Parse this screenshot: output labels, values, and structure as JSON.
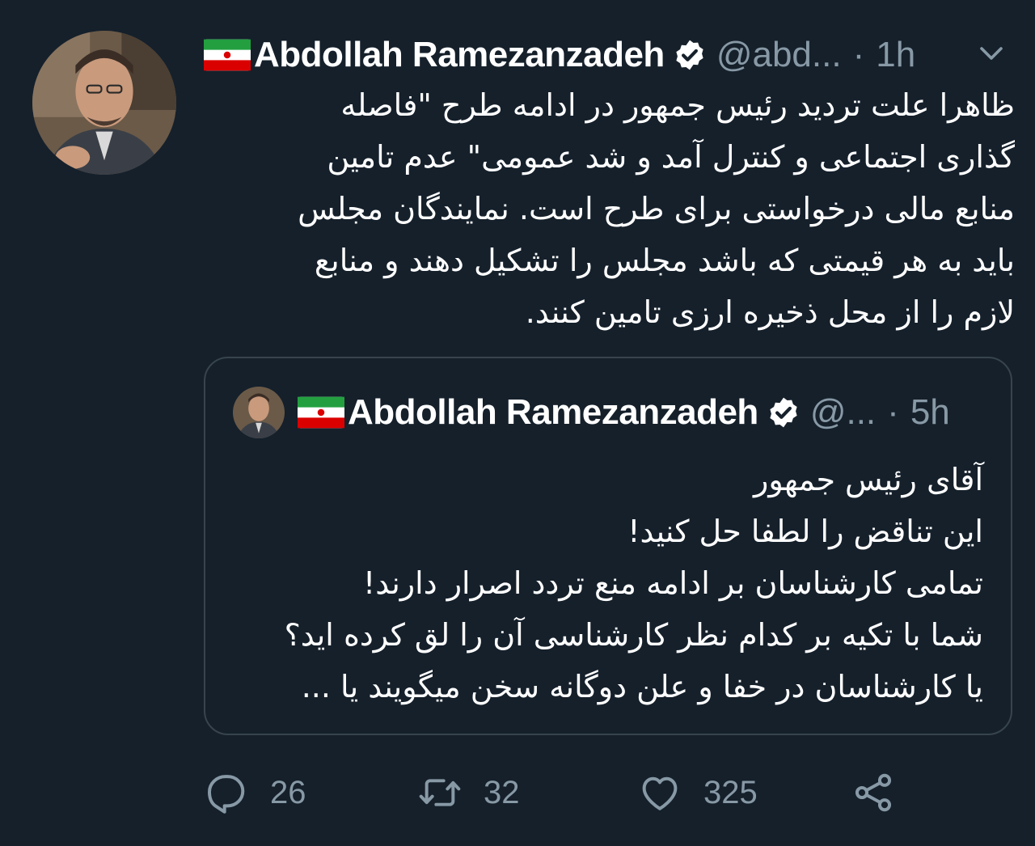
{
  "tweet": {
    "author_name": "Abdollah Ramezanzadeh",
    "author_handle": "@abd...",
    "separator": "·",
    "time": "1h",
    "text_lines": [
      "ظاهرا علت تردید رئیس جمهور در ادامه طرح \"فاصله",
      "گذاری اجتماعی و کنترل آمد و شد عمومی\" عدم تامین",
      "منابع مالی درخواستی برای طرح است. نمایندگان مجلس",
      "باید به هر قیمتی که باشد مجلس را تشکیل دهند و منابع",
      "لازم را از محل ذخیره ارزی تامین کنند."
    ]
  },
  "quoted_tweet": {
    "author_name": "Abdollah Ramezanzadeh",
    "author_handle": "@...",
    "separator": "·",
    "time": "5h",
    "text_lines": [
      "آقای رئیس جمهور",
      "این تناقض را لطفا حل کنید!",
      "تمامی کارشناسان بر ادامه منع تردد اصرار دارند!",
      "شما با تکیه بر کدام نظر کارشناسی آن را لق کرده اید؟",
      "یا کارشناسان در خفا و علن دوگانه سخن میگویند یا ..."
    ]
  },
  "actions": {
    "reply_count": "26",
    "retweet_count": "32",
    "like_count": "325"
  },
  "icons": {
    "flag": "iran-flag-icon",
    "verified": "verified-badge-icon",
    "menu": "chevron-down-icon",
    "reply": "reply-icon",
    "retweet": "retweet-icon",
    "like": "heart-icon",
    "share": "share-icon"
  },
  "colors": {
    "background": "#15202b",
    "text": "#ffffff",
    "secondary_text": "#8899a6",
    "border": "#38444d"
  }
}
